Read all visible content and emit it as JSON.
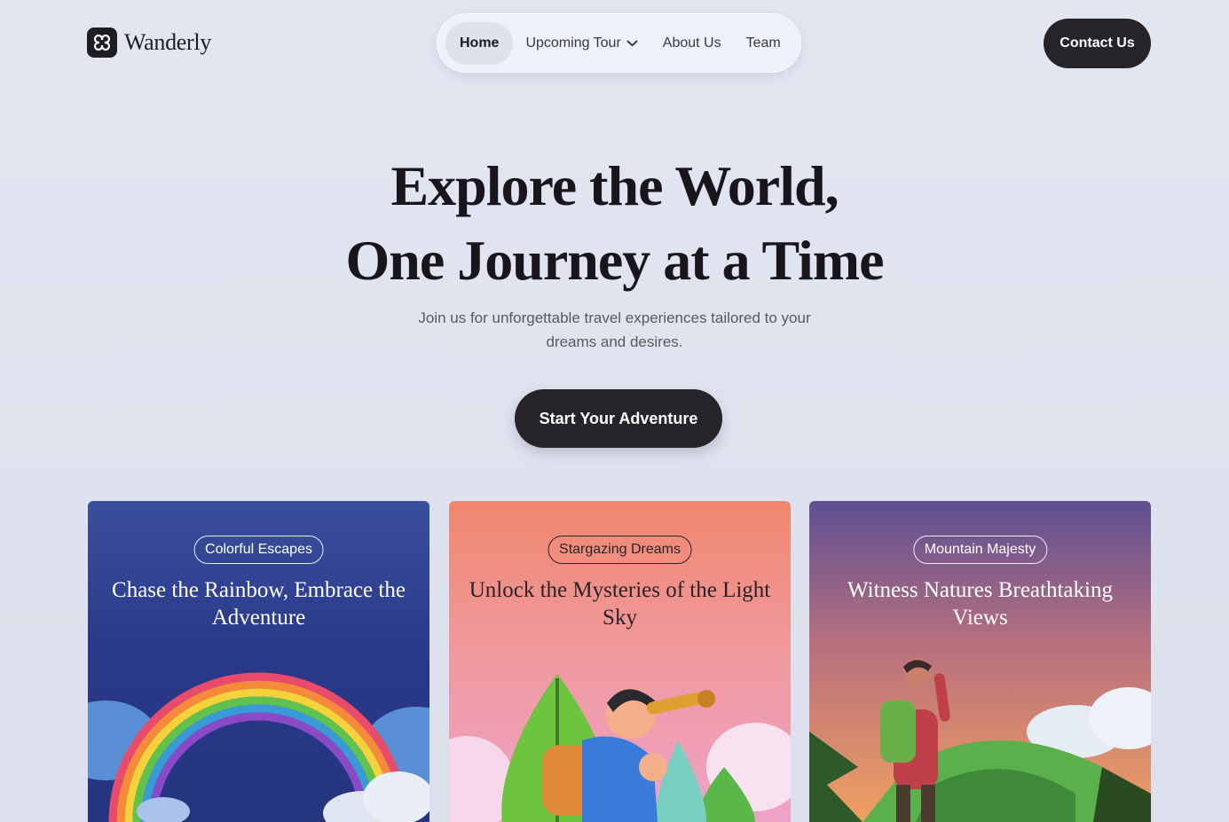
{
  "brand": {
    "name": "Wanderly",
    "icon": "clover-logo-icon"
  },
  "nav": {
    "items": [
      {
        "label": "Home",
        "active": true
      },
      {
        "label": "Upcoming Tour",
        "has_dropdown": true
      },
      {
        "label": "About Us"
      },
      {
        "label": "Team"
      }
    ]
  },
  "header": {
    "contact_label": "Contact Us"
  },
  "hero": {
    "title_line1": "Explore the World,",
    "title_line2": "One Journey at a Time",
    "subtitle": "Join us for unforgettable travel experiences tailored to your dreams and desires.",
    "cta_label": "Start Your Adventure"
  },
  "cards": [
    {
      "tag": "Colorful Escapes",
      "title": "Chase the Rainbow, Embrace the Adventure",
      "illustration": "rainbow"
    },
    {
      "tag": "Stargazing Dreams",
      "title": "Unlock the Mysteries of the Light Sky",
      "illustration": "explorer-with-telescope"
    },
    {
      "tag": "Mountain Majesty",
      "title": "Witness Natures Breathtaking Views",
      "illustration": "hiker-on-hill"
    }
  ],
  "colors": {
    "background": "#dde2ee",
    "dark_button": "#262329",
    "card1_sky": "#2b3f8f",
    "card2_sky": "#f0907a",
    "card3_sky": "#6a5a9a"
  }
}
